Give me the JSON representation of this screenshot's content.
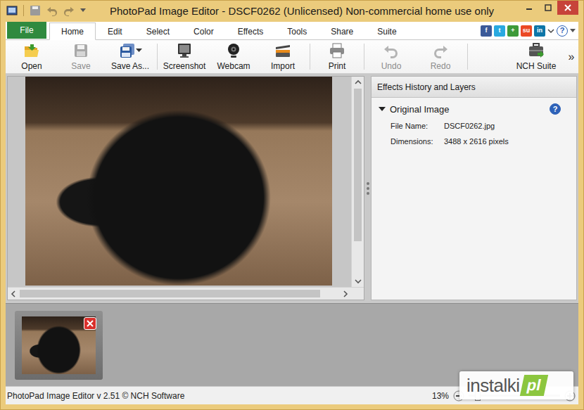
{
  "window": {
    "title": "PhotoPad Image Editor - DSCF0262 (Unlicensed) Non-commercial home use only"
  },
  "ribbon": {
    "file_button": "File",
    "tabs": [
      {
        "label": "Home",
        "selected": true
      },
      {
        "label": "Edit",
        "selected": false
      },
      {
        "label": "Select",
        "selected": false
      },
      {
        "label": "Color",
        "selected": false
      },
      {
        "label": "Effects",
        "selected": false
      },
      {
        "label": "Tools",
        "selected": false
      },
      {
        "label": "Share",
        "selected": false
      },
      {
        "label": "Suite",
        "selected": false
      }
    ],
    "social": [
      {
        "glyph": "f",
        "color": "#3b5998"
      },
      {
        "glyph": "t",
        "color": "#29a9e0"
      },
      {
        "glyph": "+",
        "color": "#3e9a3a"
      },
      {
        "glyph": "su",
        "color": "#eb4924"
      },
      {
        "glyph": "in",
        "color": "#0e76a8"
      }
    ],
    "help": "?"
  },
  "toolbar": {
    "groups": [
      [
        {
          "label": "Open",
          "disabled": false,
          "dropdown": false
        },
        {
          "label": "Save",
          "disabled": true,
          "dropdown": false
        },
        {
          "label": "Save As...",
          "disabled": false,
          "dropdown": true
        }
      ],
      [
        {
          "label": "Screenshot",
          "disabled": false,
          "dropdown": false
        },
        {
          "label": "Webcam",
          "disabled": false,
          "dropdown": false
        },
        {
          "label": "Import",
          "disabled": false,
          "dropdown": false
        }
      ],
      [
        {
          "label": "Print",
          "disabled": false,
          "dropdown": false
        }
      ],
      [
        {
          "label": "Undo",
          "disabled": true,
          "dropdown": false
        },
        {
          "label": "Redo",
          "disabled": true,
          "dropdown": false
        }
      ]
    ],
    "right": [
      {
        "label": "NCH Suite",
        "disabled": false,
        "dropdown": false
      }
    ],
    "more": "»"
  },
  "editor": {
    "vertical_scroll": {
      "level": 0.82
    },
    "horizontal_scroll": {
      "level": 0.94
    }
  },
  "layers_panel": {
    "title": "Effects History and Layers",
    "section": {
      "title": "Original Image",
      "expanded": true,
      "help": "?",
      "fields": [
        {
          "label": "File Name:",
          "value": "DSCF0262.jpg"
        },
        {
          "label": "Dimensions:",
          "value": "3488 x 2616 pixels"
        }
      ]
    }
  },
  "thumbnails": [
    {
      "selected": true
    }
  ],
  "status_bar": {
    "text": "PhotoPad Image Editor v 2.51 © NCH Software",
    "zoom": "13%",
    "zoom_level": 0.1
  },
  "watermark": {
    "text": "instalki",
    "suffix": "pl"
  }
}
